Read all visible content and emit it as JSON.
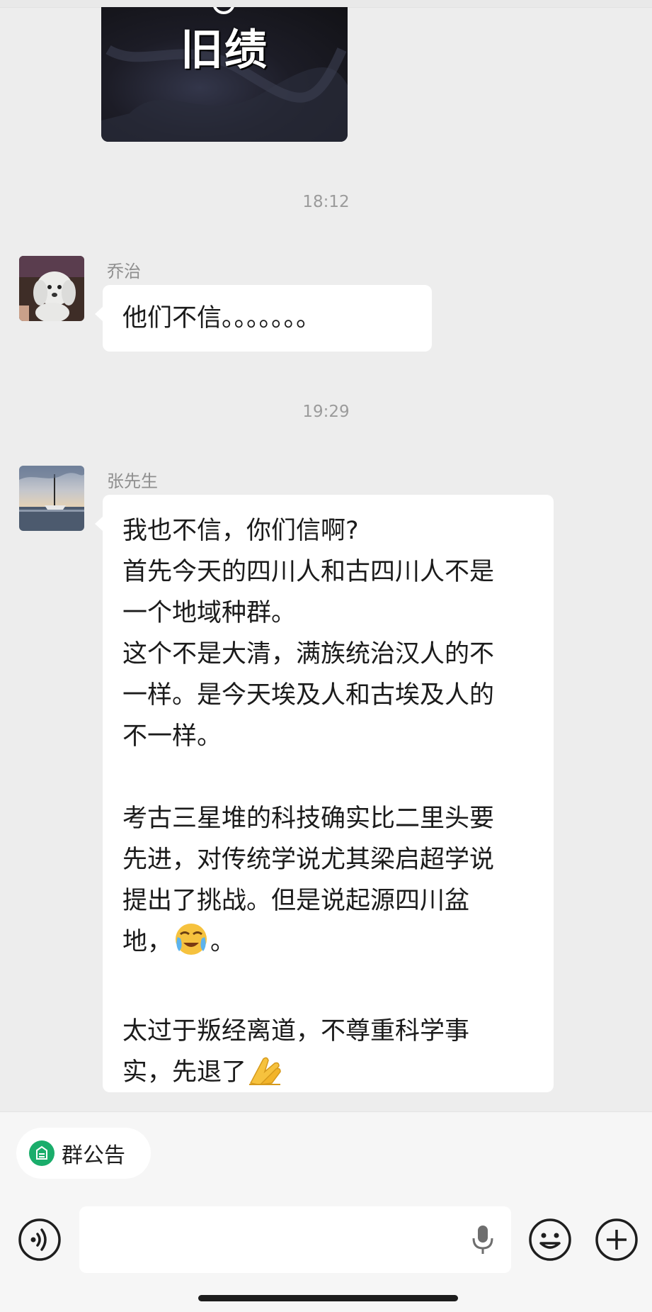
{
  "image_message": {
    "overlay_text": "旧绩"
  },
  "timestamps": [
    "18:12",
    "19:29"
  ],
  "messages": [
    {
      "sender": "乔治",
      "avatar_icon": "dog-avatar",
      "text": "他们不信。。。。。。。"
    },
    {
      "sender": "张先生",
      "avatar_icon": "sailboat-avatar",
      "lines": [
        "我也不信，你们信啊?",
        "首先今天的四川人和古四川人不是",
        "一个地域种群。",
        "这个不是大清，满族统治汉人的不",
        "一样。是今天埃及人和古埃及人的",
        "不一样。",
        "考古三星堆的科技确实比二里头要",
        "先进，对传统学说尤其梁启超学说",
        "提出了挑战。但是说起源四川盆",
        "地，",
        "。",
        "太过于叛经离道，不尊重科学事",
        "实，先退了"
      ],
      "emojis": [
        "crying-face-emoji",
        "pray-hands-emoji"
      ]
    }
  ],
  "bottom_bar": {
    "notice_label": "群公告",
    "input_value": "",
    "icons": [
      "voice-icon",
      "mic-icon",
      "emoji-icon",
      "plus-icon"
    ]
  },
  "colors": {
    "background": "#ededed",
    "bubble": "#ffffff",
    "notice_green": "#1aad6b"
  }
}
